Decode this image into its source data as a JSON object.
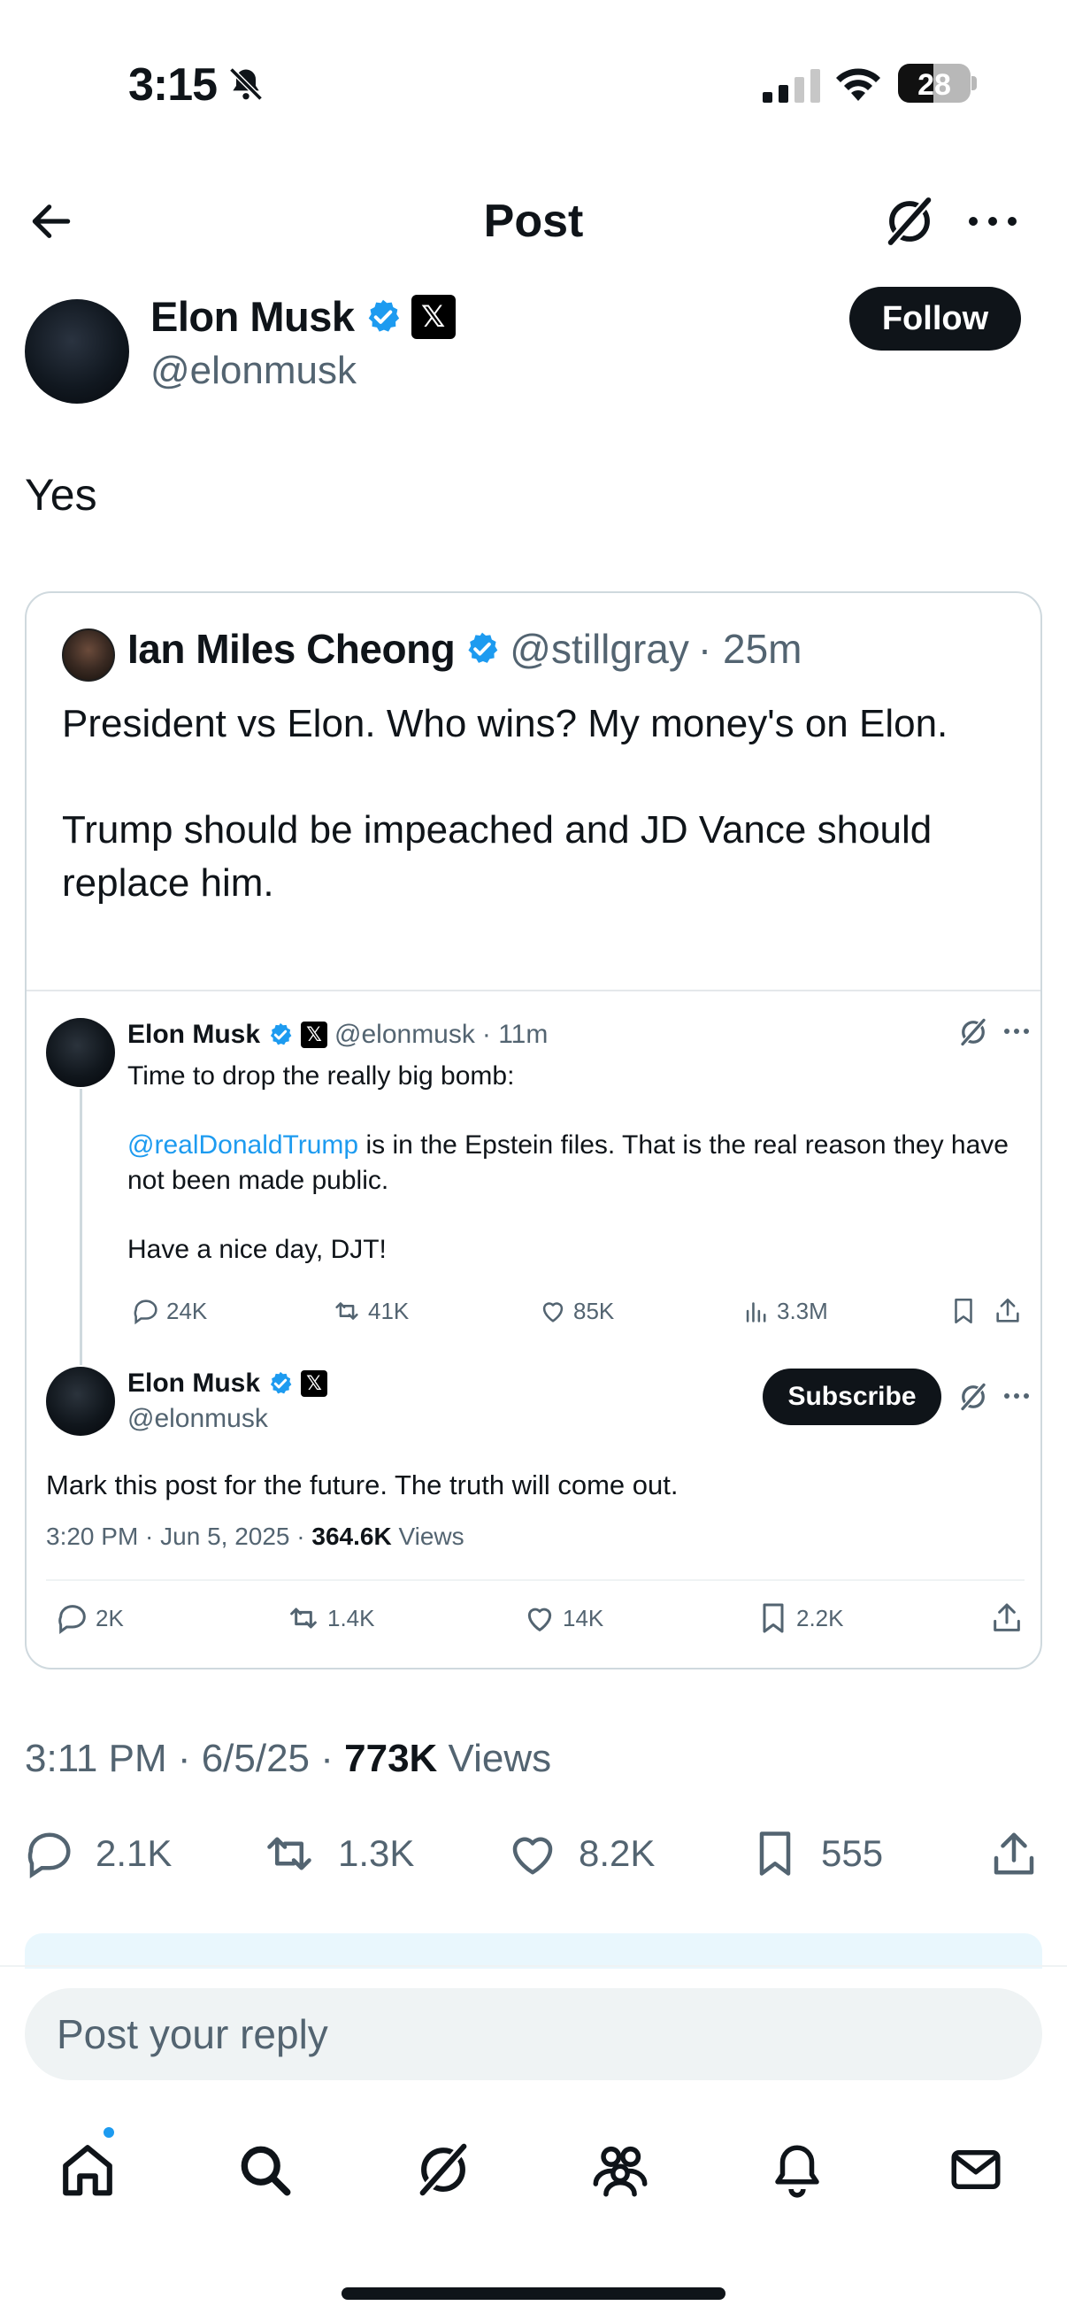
{
  "status_bar": {
    "time": "3:15",
    "battery": "28"
  },
  "header": {
    "title": "Post"
  },
  "post": {
    "author_name": "Elon Musk",
    "author_handle": "@elonmusk",
    "follow_label": "Follow",
    "text": "Yes",
    "timestamp": "3:11 PM · 6/5/25 · ",
    "views_count": "773K",
    "views_label": " Views",
    "actions": {
      "replies": "2.1K",
      "reposts": "1.3K",
      "likes": "8.2K",
      "bookmarks": "555"
    }
  },
  "quote": {
    "author_name": "Ian Miles Cheong",
    "author_handle": "@stillgray",
    "age": "· 25m",
    "text": "President vs Elon. Who wins? My money's on Elon.\n\nTrump should be impeached and JD Vance should replace him.",
    "embedded": {
      "first": {
        "author_name": "Elon Musk",
        "author_handle": "@elonmusk",
        "age": "· 11m",
        "line1": "Time to drop the really big bomb:",
        "mention": "@realDonaldTrump",
        "line2": " is in the Epstein files. That is the real reason they have not been made public.",
        "line3": "Have a nice day, DJT!",
        "actions": {
          "replies": "24K",
          "reposts": "41K",
          "likes": "85K",
          "views": "3.3M"
        }
      },
      "second": {
        "author_name": "Elon Musk",
        "author_handle": "@elonmusk",
        "subscribe_label": "Subscribe",
        "text": "Mark this post for the future. The truth will come out.",
        "timestamp": "3:20 PM · Jun 5, 2025 · ",
        "views_count": "364.6K",
        "views_label": " Views",
        "actions": {
          "replies": "2K",
          "reposts": "1.4K",
          "likes": "14K",
          "bookmarks": "2.2K"
        }
      }
    }
  },
  "reply": {
    "placeholder": "Post your reply"
  },
  "tabs": [
    "home-icon",
    "search-icon",
    "grok-icon",
    "communities-icon",
    "notifications-icon",
    "messages-icon"
  ],
  "colors": {
    "verified": "#1d9bf0",
    "text": "#0f1419",
    "secondary": "#536471",
    "link": "#1d9bf0"
  }
}
